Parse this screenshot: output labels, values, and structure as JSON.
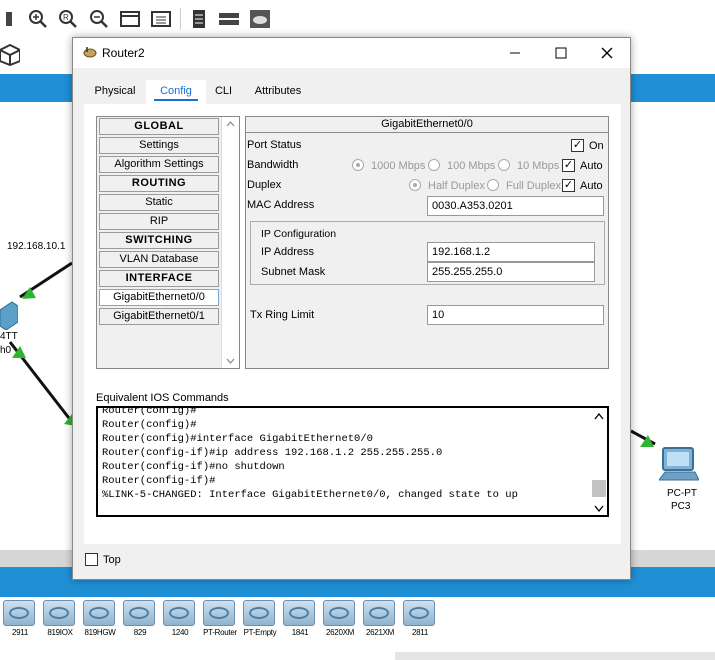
{
  "workspace": {
    "ip_label": "192.168.10.1",
    "left_device_label_1": "4TT",
    "left_device_label_2": "h0",
    "pc_label_1": "PC-PT",
    "pc_label_2": "PC3"
  },
  "device_strip": [
    "2911",
    "819IOX",
    "819HGW",
    "829",
    "1240",
    "PT-Router",
    "PT-Empty",
    "1841",
    "2620XM",
    "2621XM",
    "2811"
  ],
  "dialog": {
    "title": "Router2",
    "tabs": [
      "Physical",
      "Config",
      "CLI",
      "Attributes"
    ],
    "active_tab": "Config",
    "sidebar": {
      "global_header": "GLOBAL",
      "settings": "Settings",
      "algorithm_settings": "Algorithm Settings",
      "routing_header": "ROUTING",
      "static": "Static",
      "rip": "RIP",
      "switching_header": "SWITCHING",
      "vlan_database": "VLAN Database",
      "interface_header": "INTERFACE",
      "gig0": "GigabitEthernet0/0",
      "gig1": "GigabitEthernet0/1"
    },
    "interface": {
      "heading": "GigabitEthernet0/0",
      "port_status_label": "Port Status",
      "port_status_on_label": "On",
      "port_status_on": true,
      "bandwidth_label": "Bandwidth",
      "bw_1000": "1000 Mbps",
      "bw_100": "100 Mbps",
      "bw_10": "10 Mbps",
      "bw_auto_label": "Auto",
      "duplex_label": "Duplex",
      "half_duplex": "Half Duplex",
      "full_duplex": "Full Duplex",
      "duplex_auto_label": "Auto",
      "mac_label": "MAC Address",
      "mac_value": "0030.A353.0201",
      "ip_config_label": "IP Configuration",
      "ip_label": "IP Address",
      "ip_value": "192.168.1.2",
      "mask_label": "Subnet Mask",
      "mask_value": "255.255.255.0",
      "tx_label": "Tx Ring Limit",
      "tx_value": "10"
    },
    "ios_label": "Equivalent IOS Commands",
    "ios_lines": [
      "Router(config)#",
      "Router(config)#",
      "Router(config)#interface GigabitEthernet0/0",
      "Router(config-if)#ip address 192.168.1.2 255.255.255.0",
      "Router(config-if)#no shutdown",
      "Router(config-if)#",
      "%LINK-5-CHANGED: Interface GigabitEthernet0/0, changed state to up"
    ],
    "top_label": "Top"
  }
}
